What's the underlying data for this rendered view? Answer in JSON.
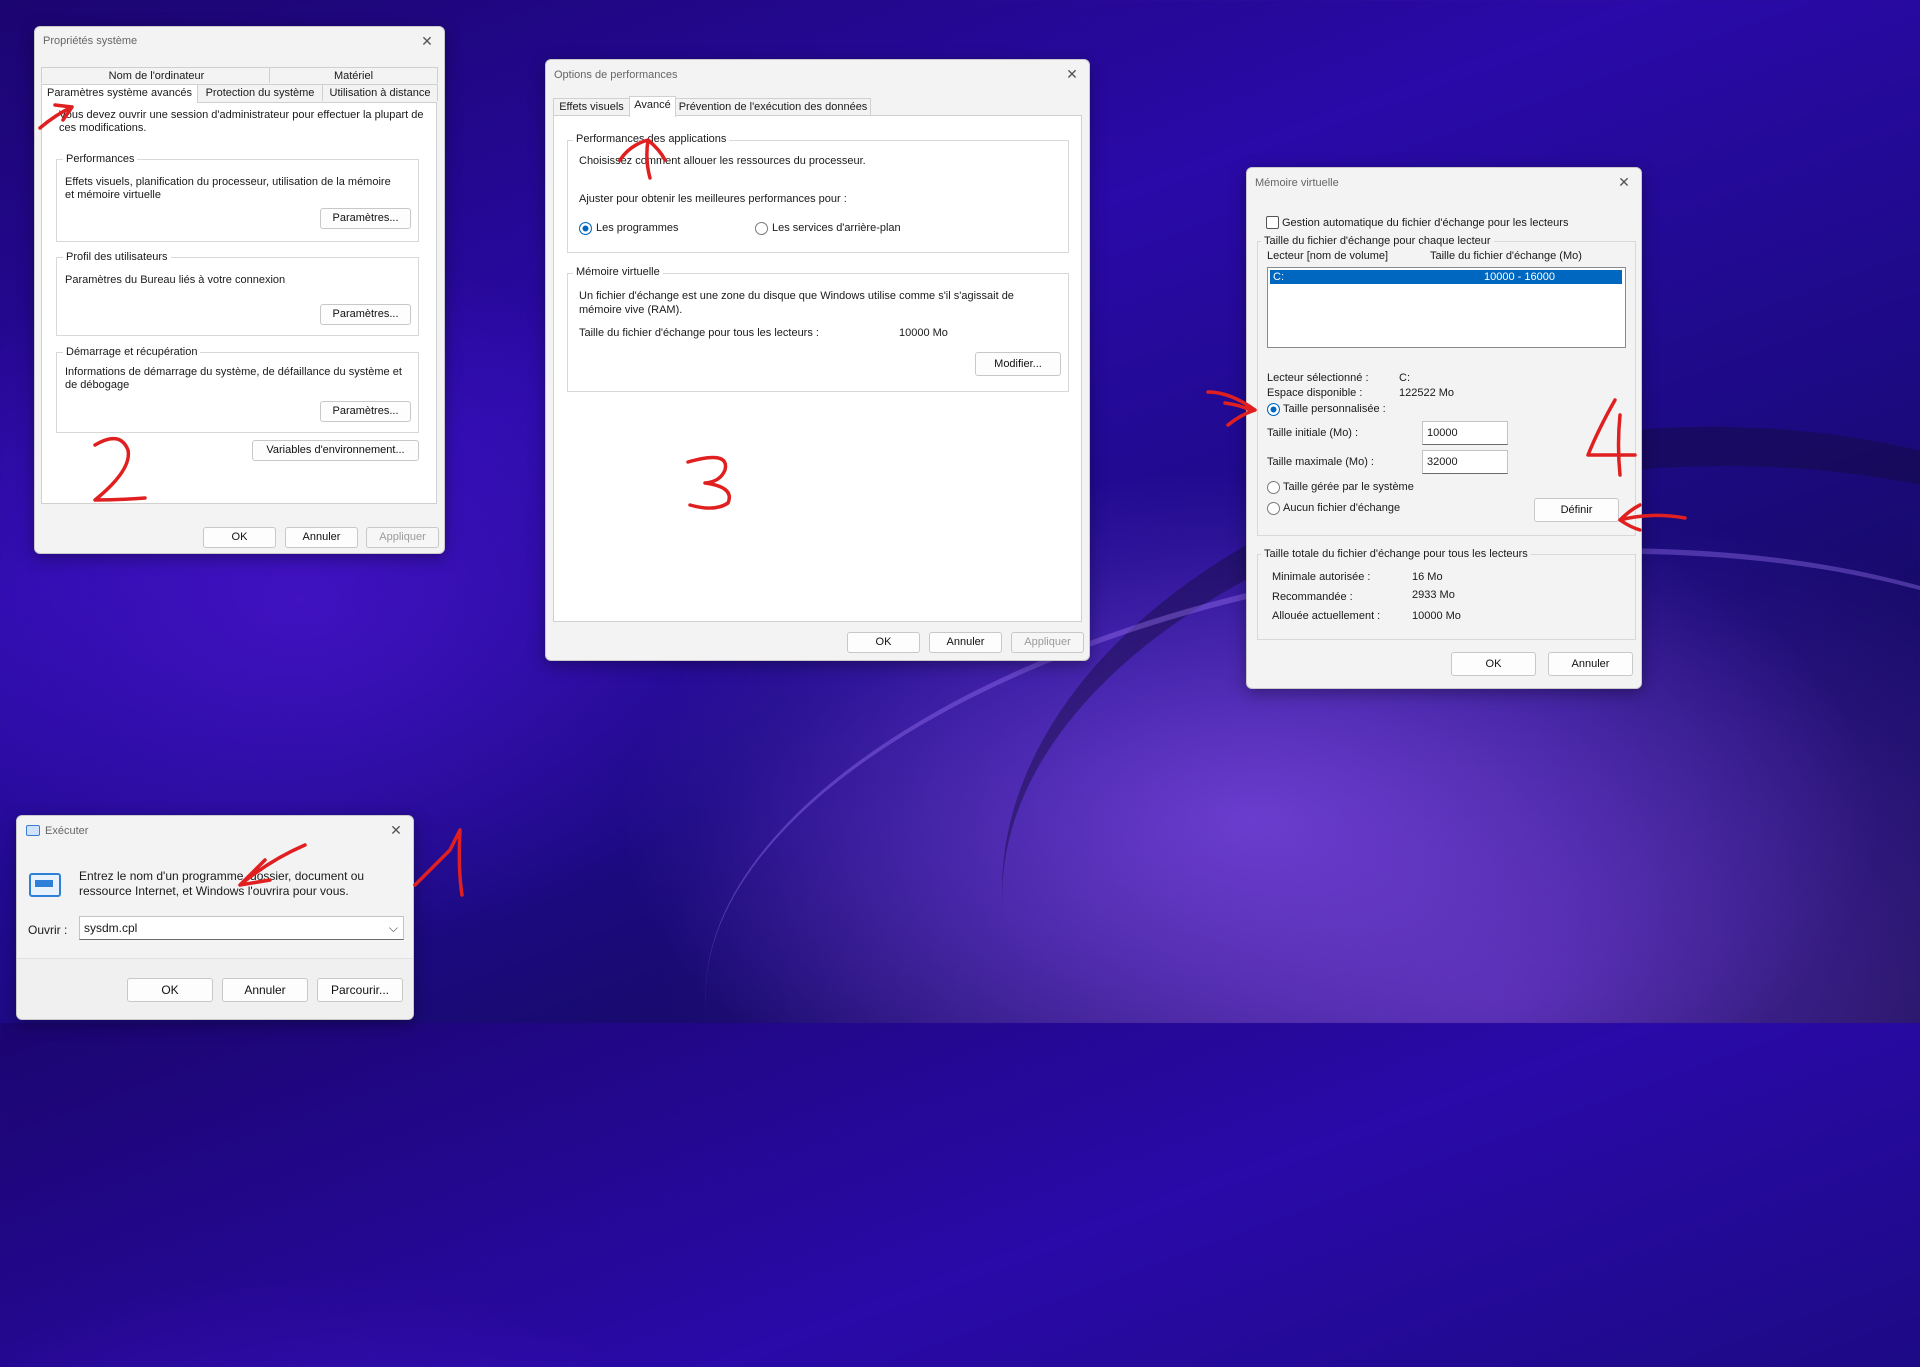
{
  "sys_props": {
    "title": "Propriétés système",
    "tabs": [
      "Nom de l'ordinateur",
      "Matériel",
      "Paramètres système avancés",
      "Protection du système",
      "Utilisation à distance"
    ],
    "admin_note": "Vous devez ouvrir une session d'administrateur pour effectuer la plupart de ces modifications.",
    "performances": {
      "label": "Performances",
      "text": "Effets visuels, planification du processeur, utilisation de la mémoire et mémoire virtuelle",
      "button": "Paramètres..."
    },
    "profil": {
      "label": "Profil des utilisateurs",
      "text": "Paramètres du Bureau liés à votre connexion",
      "button": "Paramètres..."
    },
    "demarrage": {
      "label": "Démarrage et récupération",
      "text": "Informations de démarrage du système, de défaillance du système et de débogage",
      "button": "Paramètres..."
    },
    "env_button": "Variables d'environnement...",
    "ok": "OK",
    "cancel": "Annuler",
    "apply": "Appliquer"
  },
  "perf_options": {
    "title": "Options de performances",
    "tabs": [
      "Effets visuels",
      "Avancé",
      "Prévention de l'exécution des données"
    ],
    "sched": {
      "label": "Performances des applications",
      "text": "Choisissez comment allouer les ressources du processeur.",
      "adjust": "Ajuster pour obtenir les meilleures performances pour :",
      "opt_programs": "Les programmes",
      "opt_services": "Les services d'arrière-plan",
      "selected": "programs"
    },
    "vmem": {
      "label": "Mémoire virtuelle",
      "text": "Un fichier d'échange est une zone du disque que Windows utilise comme s'il s'agissait de mémoire vive (RAM).",
      "total_label": "Taille du fichier d'échange pour tous les lecteurs :",
      "total_value": "10000 Mo",
      "button": "Modifier..."
    },
    "ok": "OK",
    "cancel": "Annuler",
    "apply": "Appliquer"
  },
  "vmem": {
    "title": "Mémoire virtuelle",
    "auto_label": "Gestion automatique du fichier d'échange pour les lecteurs",
    "auto_checked": false,
    "per_drive_label": "Taille du fichier d'échange pour chaque lecteur",
    "col_drive": "Lecteur [nom de volume]",
    "col_size": "Taille du fichier d'échange (Mo)",
    "rows": [
      {
        "drive": "C:",
        "size": "10000 - 16000"
      }
    ],
    "selected_label": "Lecteur sélectionné :",
    "selected_value": "C:",
    "free_label": "Espace disponible :",
    "free_value": "122522 Mo",
    "custom_label": "Taille personnalisée :",
    "initial_label": "Taille initiale (Mo) :",
    "initial_value": "10000",
    "max_label": "Taille maximale (Mo) :",
    "max_value": "32000",
    "system_label": "Taille gérée par le système",
    "none_label": "Aucun fichier d'échange",
    "set_button": "Définir",
    "totals_label": "Taille totale du fichier d'échange pour tous les lecteurs",
    "min_label": "Minimale autorisée :",
    "min_value": "16 Mo",
    "rec_label": "Recommandée :",
    "rec_value": "2933 Mo",
    "alloc_label": "Allouée actuellement :",
    "alloc_value": "10000 Mo",
    "ok": "OK",
    "cancel": "Annuler"
  },
  "run": {
    "title": "Exécuter",
    "text": "Entrez le nom d'un programme, dossier, document ou ressource Internet, et Windows l'ouvrira pour vous.",
    "open_label": "Ouvrir :",
    "value": "sysdm.cpl",
    "ok": "OK",
    "cancel": "Annuler",
    "browse": "Parcourir..."
  },
  "accent": "#0067c0",
  "annotation_color": "#e02020"
}
